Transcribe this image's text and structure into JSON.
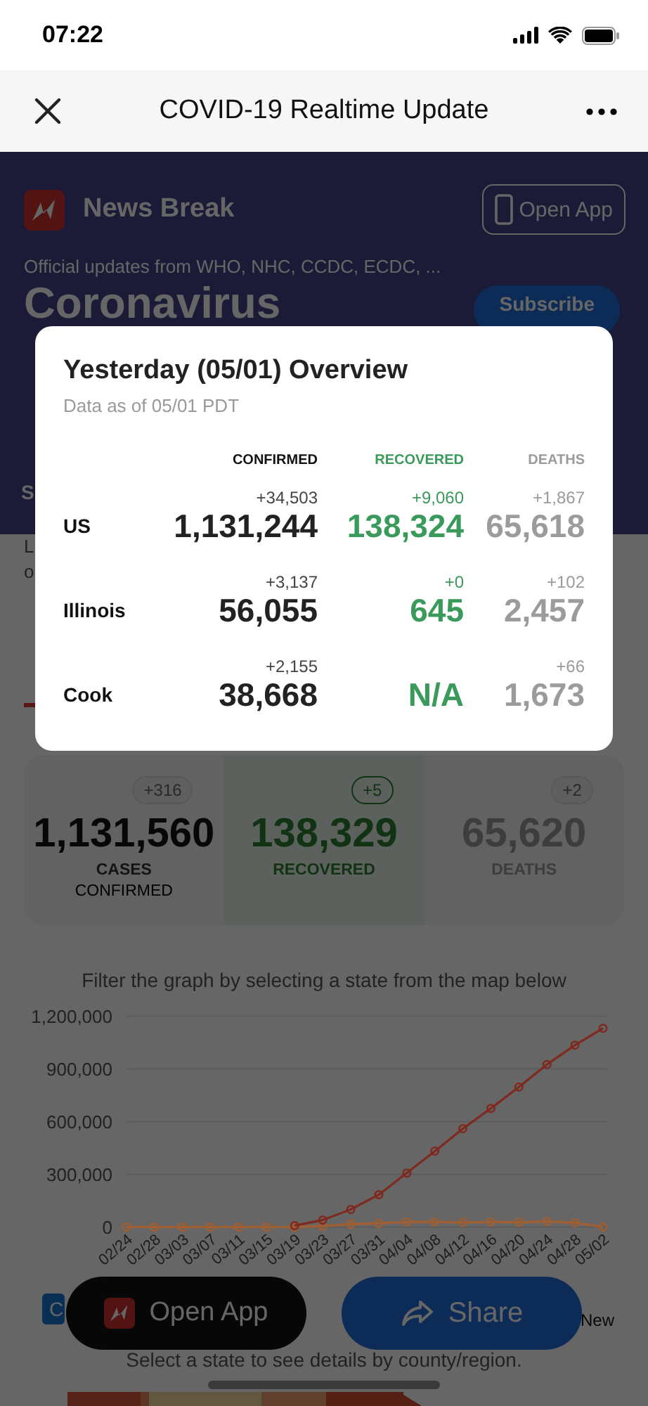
{
  "status_bar": {
    "time": "07:22"
  },
  "nav_bar": {
    "title": "COVID-19 Realtime Update"
  },
  "header": {
    "brand": "News Break",
    "open_app_button": "Open App",
    "subtitle": "Official updates from WHO, NHC, CCDC, ECDC, ...",
    "title": "Coronavirus",
    "subscribe_button": "Subscribe",
    "fragment": "S"
  },
  "body_fragments": [
    "L",
    "o"
  ],
  "summary_cards": [
    {
      "kind": "confirmed",
      "badge": "+316",
      "value": "1,131,560",
      "label": "CASES",
      "sublabel": "CONFIRMED"
    },
    {
      "kind": "recovered",
      "badge": "+5",
      "value": "138,329",
      "label": "RECOVERED"
    },
    {
      "kind": "deaths",
      "badge": "+2",
      "value": "65,620",
      "label": "DEATHS"
    }
  ],
  "chart_caption": "Filter the graph by selecting a state from the map below",
  "chart": {
    "chart_data": {
      "type": "line",
      "categories": [
        "02/24",
        "02/28",
        "03/03",
        "03/07",
        "03/11",
        "03/15",
        "03/19",
        "03/23",
        "03/27",
        "03/31",
        "04/04",
        "04/08",
        "04/12",
        "04/16",
        "04/20",
        "04/24",
        "04/28",
        "05/02"
      ],
      "series": [
        {
          "color": "#7e2a1f",
          "marker": "circle",
          "values": [
            null,
            null,
            null,
            null,
            null,
            null,
            8000,
            40000,
            100000,
            184000,
            307000,
            432000,
            560000,
            675000,
            797000,
            925000,
            1035000,
            1131000
          ]
        },
        {
          "color": "#a15e30",
          "marker": "circle",
          "values": [
            0,
            0,
            0,
            0,
            0,
            0,
            0,
            5000,
            16000,
            21000,
            29000,
            29000,
            26000,
            29000,
            27000,
            32000,
            24000,
            0
          ]
        }
      ],
      "ylim": [
        0,
        1200000
      ],
      "grid": true,
      "yticks": [
        {
          "value": 0,
          "label": "0"
        },
        {
          "value": 300000,
          "label": "300,000"
        },
        {
          "value": 600000,
          "label": "600,000"
        },
        {
          "value": 900000,
          "label": "900,000"
        },
        {
          "value": 1200000,
          "label": "1,200,000"
        }
      ]
    }
  },
  "legend": {
    "chip": "C",
    "label": "New"
  },
  "map_caption": "Select a state to see details by county/region.",
  "map": {
    "kind": "picture"
  },
  "floating_buttons": [
    {
      "kind": "open_app",
      "label": "Open App"
    },
    {
      "kind": "share",
      "label": "Share"
    }
  ],
  "overview_modal": {
    "title": "Yesterday (05/01) Overview",
    "subtitle": "Data as of 05/01 PDT",
    "columns": [
      {
        "kind": "confirmed",
        "label": "CONFIRMED"
      },
      {
        "kind": "recovered",
        "label": "RECOVERED"
      },
      {
        "kind": "deaths",
        "label": "DEATHS"
      }
    ],
    "rows": [
      {
        "region": "US",
        "cells": [
          {
            "change": "+34,503",
            "value": "1,131,244"
          },
          {
            "change": "+9,060",
            "value": "138,324"
          },
          {
            "change": "+1,867",
            "value": "65,618"
          }
        ]
      },
      {
        "region": "Illinois",
        "cells": [
          {
            "change": "+3,137",
            "value": "56,055"
          },
          {
            "change": "+0",
            "value": "645"
          },
          {
            "change": "+102",
            "value": "2,457"
          }
        ]
      },
      {
        "region": "Cook",
        "cells": [
          {
            "change": "+2,155",
            "value": "38,668"
          },
          {
            "value": "N/A"
          },
          {
            "change": "+66",
            "value": "1,673"
          }
        ]
      }
    ]
  }
}
